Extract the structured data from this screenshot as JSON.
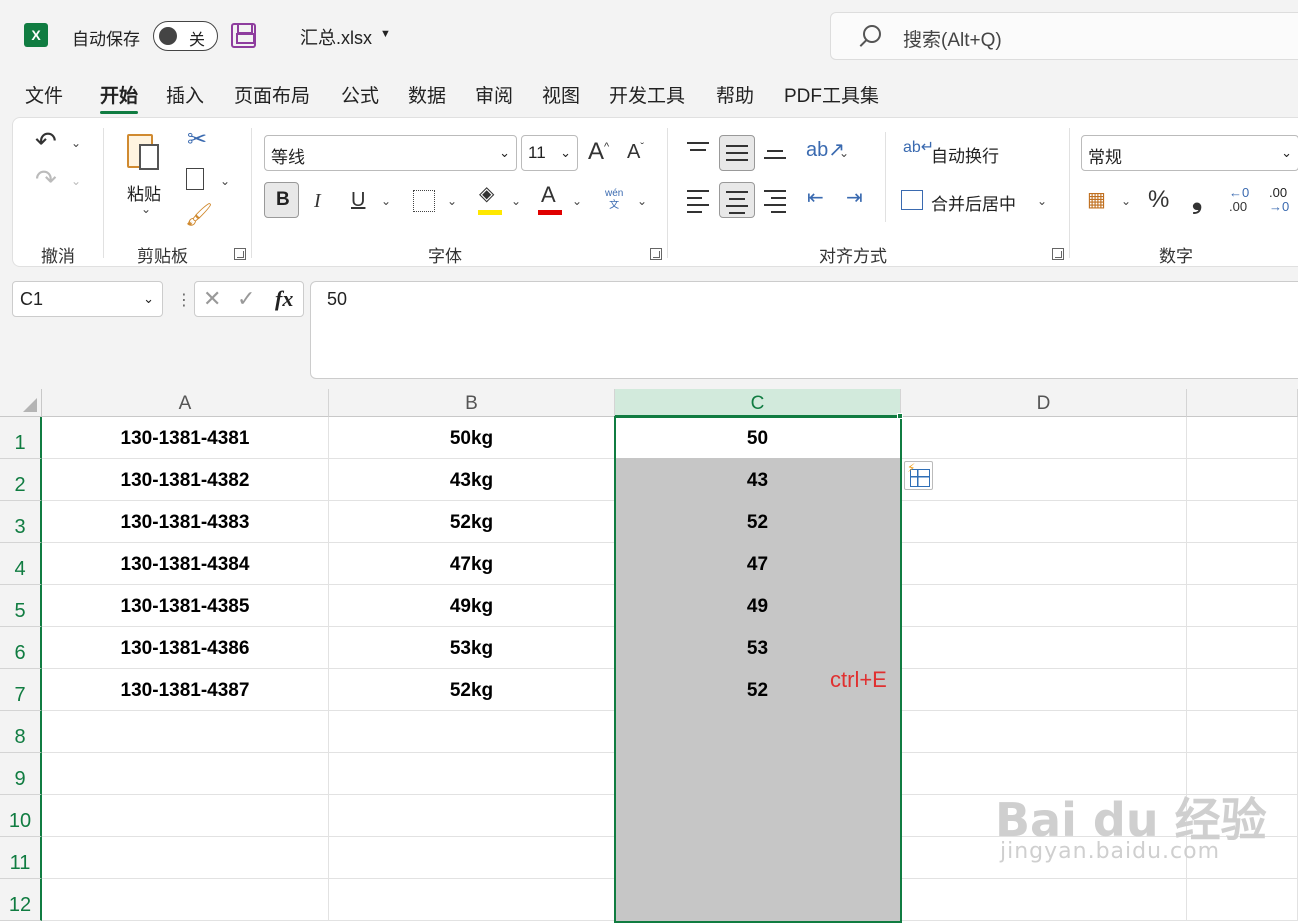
{
  "titlebar": {
    "autosave_label": "自动保存",
    "autosave_state": "关",
    "filename": "汇总.xlsx",
    "search_placeholder": "搜索(Alt+Q)"
  },
  "tabs": [
    "文件",
    "开始",
    "插入",
    "页面布局",
    "公式",
    "数据",
    "审阅",
    "视图",
    "开发工具",
    "帮助",
    "PDF工具集"
  ],
  "active_tab": "开始",
  "ribbon": {
    "undo_group": "撤消",
    "clipboard_group": "剪贴板",
    "paste_label": "粘贴",
    "font_group": "字体",
    "font_name": "等线",
    "font_size": "11",
    "bold": "B",
    "italic": "I",
    "underline": "U",
    "font_color_glyph": "A",
    "grow_font": "A",
    "shrink_font": "A",
    "phonetic_top": "wén",
    "phonetic_bottom": "文",
    "align_group": "对齐方式",
    "wrap_text": "自动换行",
    "merge_center": "合并后居中",
    "number_group": "数字",
    "number_format": "常规",
    "percent": "%",
    "comma": "❟",
    "inc_decimal_top": "←0",
    "inc_decimal_bottom": ".00",
    "dec_decimal_top": ".00",
    "dec_decimal_bottom": "→0",
    "fill_color": "#ffe800",
    "font_color": "#e00000"
  },
  "formula_bar": {
    "name_box": "C1",
    "fx": "fx",
    "value": "50"
  },
  "sheet": {
    "columns": [
      "A",
      "B",
      "C",
      "D"
    ],
    "rows": [
      {
        "num": "1",
        "a": "130-1381-4381",
        "b": "50kg",
        "c": "50"
      },
      {
        "num": "2",
        "a": "130-1381-4382",
        "b": "43kg",
        "c": "43"
      },
      {
        "num": "3",
        "a": "130-1381-4383",
        "b": "52kg",
        "c": "52"
      },
      {
        "num": "4",
        "a": "130-1381-4384",
        "b": "47kg",
        "c": "47"
      },
      {
        "num": "5",
        "a": "130-1381-4385",
        "b": "49kg",
        "c": "49"
      },
      {
        "num": "6",
        "a": "130-1381-4386",
        "b": "53kg",
        "c": "53"
      },
      {
        "num": "7",
        "a": "130-1381-4387",
        "b": "52kg",
        "c": "52"
      },
      {
        "num": "8",
        "a": "",
        "b": "",
        "c": ""
      },
      {
        "num": "9",
        "a": "",
        "b": "",
        "c": ""
      },
      {
        "num": "10",
        "a": "",
        "b": "",
        "c": ""
      },
      {
        "num": "11",
        "a": "",
        "b": "",
        "c": ""
      },
      {
        "num": "12",
        "a": "",
        "b": "",
        "c": ""
      }
    ],
    "annotation": "ctrl+E"
  },
  "watermark": {
    "logo": "Bai du 经验",
    "url": "jingyan.baidu.com"
  },
  "colors": {
    "accent": "#107c41",
    "selection_fill": "#c6c6c6",
    "annotation": "#e03030"
  }
}
